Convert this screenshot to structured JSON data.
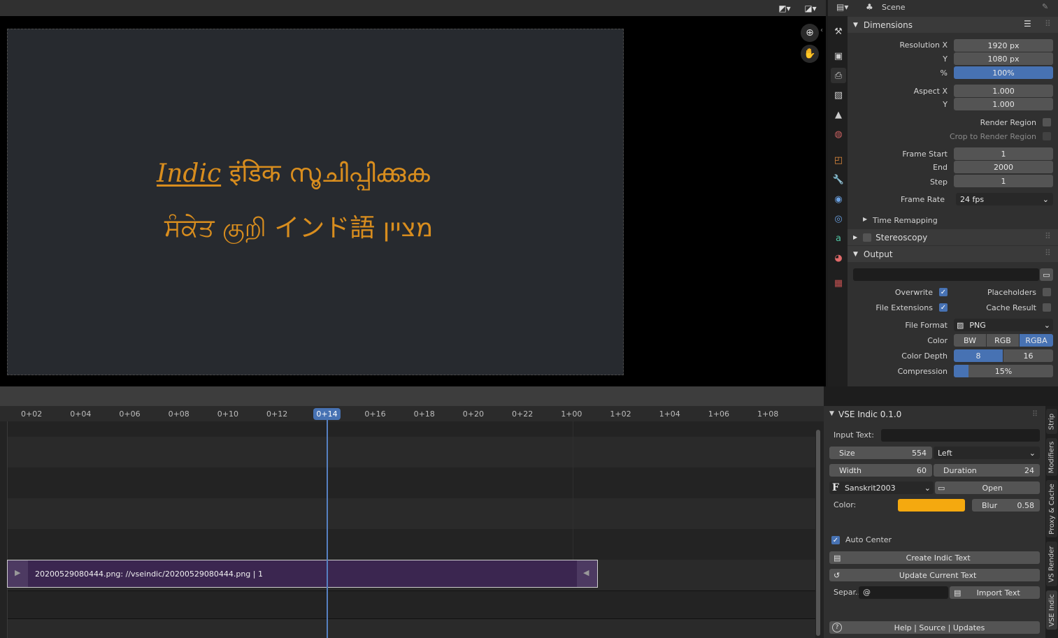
{
  "preview": {
    "line1_a": "Indic",
    "line1_b": " इंडिक സൂചിപ്പിക്കുക",
    "line2": "ਸੰਕੇਤ குறி インド語 מציין"
  },
  "properties": {
    "header_title": "Scene",
    "dimensions": {
      "title": "Dimensions",
      "res_x_label": "Resolution X",
      "res_x": "1920 px",
      "res_y_label": "Y",
      "res_y": "1080 px",
      "pct_label": "%",
      "pct": "100%",
      "aspect_x_label": "Aspect X",
      "aspect_x": "1.000",
      "aspect_y_label": "Y",
      "aspect_y": "1.000",
      "render_region": "Render Region",
      "crop_region": "Crop to Render Region",
      "frame_start_label": "Frame Start",
      "frame_start": "1",
      "end_label": "End",
      "end": "2000",
      "step_label": "Step",
      "step": "1",
      "frame_rate_label": "Frame Rate",
      "frame_rate": "24 fps",
      "time_remapping": "Time Remapping"
    },
    "stereoscopy": "Stereoscopy",
    "output": {
      "title": "Output",
      "overwrite": "Overwrite",
      "placeholders": "Placeholders",
      "file_extensions": "File Extensions",
      "cache_result": "Cache Result",
      "file_format_label": "File Format",
      "file_format": "PNG",
      "color_label": "Color",
      "color_bw": "BW",
      "color_rgb": "RGB",
      "color_rgba": "RGBA",
      "depth_label": "Color Depth",
      "depth_8": "8",
      "depth_16": "16",
      "compression_label": "Compression",
      "compression": "15%",
      "compression_value": 0.15
    }
  },
  "timeline": {
    "ticks": [
      "0+02",
      "0+04",
      "0+06",
      "0+08",
      "0+10",
      "0+12",
      "0+14",
      "0+16",
      "0+18",
      "0+20",
      "0+22",
      "1+00",
      "1+02",
      "1+04",
      "1+06",
      "1+08"
    ],
    "current": "0+14",
    "strip_label": "20200529080444.png: //vseindic/20200529080444.png | 1"
  },
  "vse": {
    "title": "VSE Indic 0.1.0",
    "input_text_label": "Input Text:",
    "size_label": "Size",
    "size": "554",
    "align": "Left",
    "width_label": "Width",
    "width": "60",
    "duration_label": "Duration",
    "duration": "24",
    "font": "Sanskrit2003",
    "open": "Open",
    "color_label": "Color:",
    "color_hex": "#f5a90f",
    "blur_label": "Blur",
    "blur": "0.58",
    "auto_center": "Auto Center",
    "create": "Create Indic Text",
    "update": "Update Current Text",
    "separator_label": "Separ..",
    "separator_value": "@",
    "import": "Import Text",
    "help": "Help | Source | Updates",
    "tabs": [
      "Strip",
      "Modifiers",
      "Proxy & Cache",
      "VS Render",
      "VSE Indic"
    ]
  }
}
